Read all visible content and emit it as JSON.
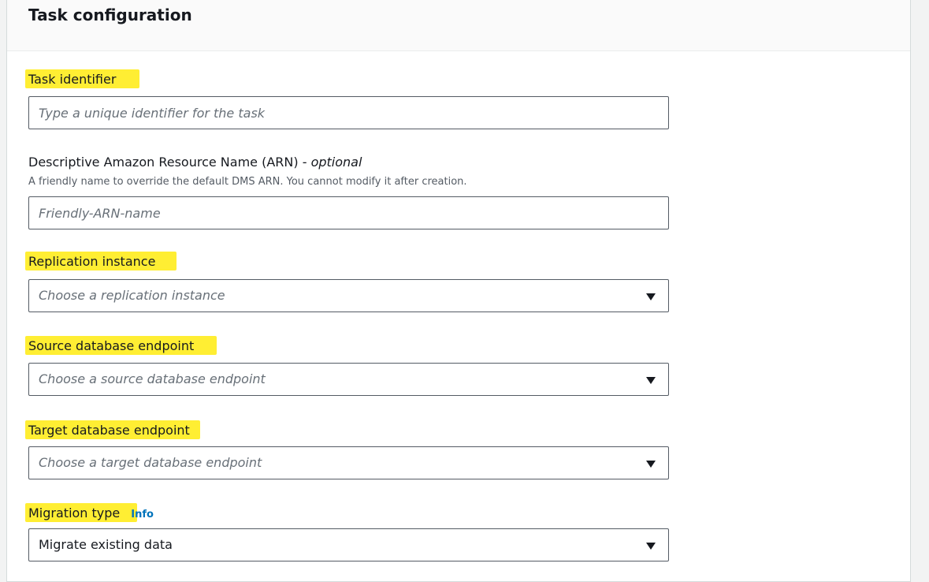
{
  "panel": {
    "title": "Task configuration"
  },
  "task_identifier": {
    "label": "Task identifier",
    "placeholder": "Type a unique identifier for the task"
  },
  "arn": {
    "label": "Descriptive Amazon Resource Name (ARN) - ",
    "optional_text": "optional",
    "description": "A friendly name to override the default DMS ARN. You cannot modify it after creation.",
    "placeholder": "Friendly-ARN-name"
  },
  "replication_instance": {
    "label": "Replication instance",
    "selected": "Choose a replication instance"
  },
  "source_endpoint": {
    "label": "Source database endpoint",
    "selected": "Choose a source database endpoint"
  },
  "target_endpoint": {
    "label": "Target database endpoint",
    "selected": "Choose a target database endpoint"
  },
  "migration_type": {
    "label": "Migration type",
    "info_link": "Info",
    "selected": "Migrate existing data"
  },
  "colors": {
    "highlight": "#ffee33",
    "info_link": "#0073bb",
    "border": "#545b64",
    "placeholder": "#687078"
  }
}
